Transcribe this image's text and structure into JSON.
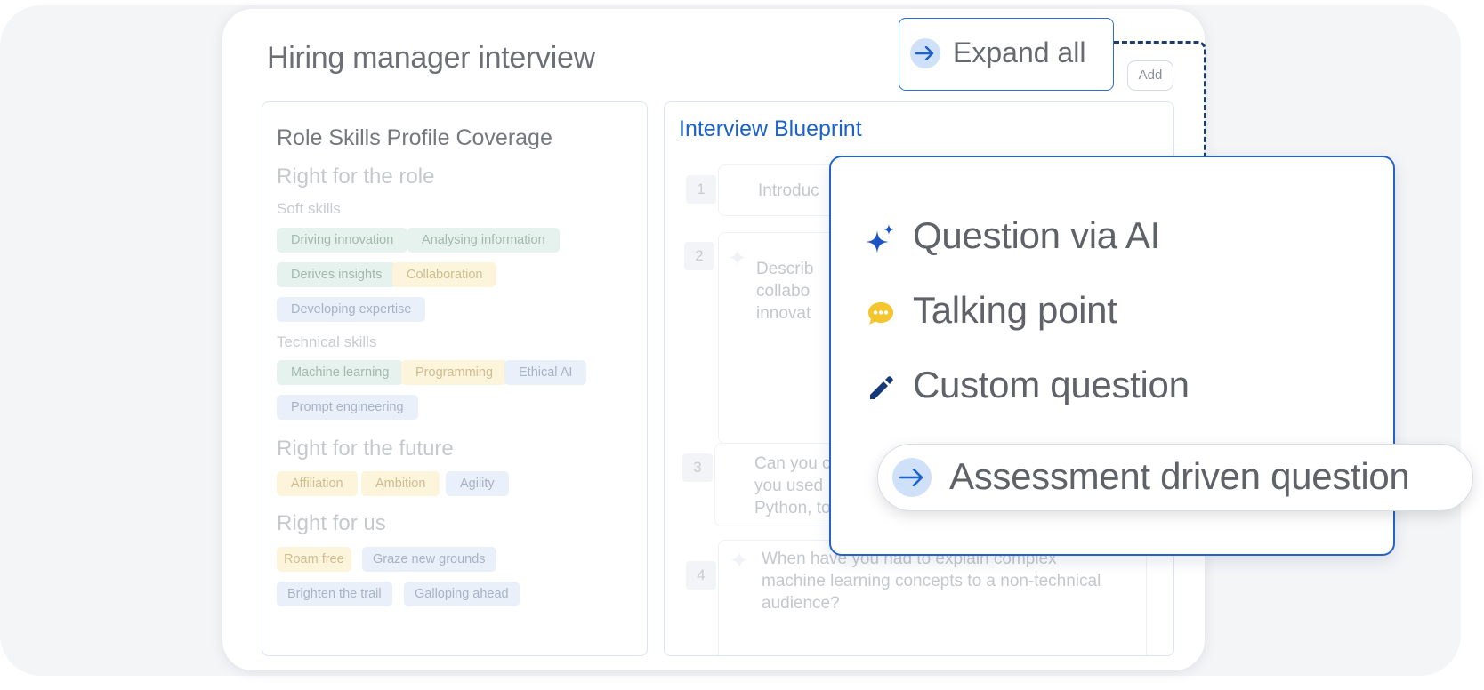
{
  "card": {
    "title": "Hiring manager interview",
    "add_label": "Add"
  },
  "skills": {
    "title": "Role Skills Profile Coverage",
    "sections": [
      {
        "heading": "Right for the role",
        "groups": [
          {
            "subheading": "Soft skills",
            "tags": [
              "Driving innovation",
              "Analysing information",
              "Derives insights",
              "Collaboration",
              "Developing expertise"
            ]
          },
          {
            "subheading": "Technical skills",
            "tags": [
              "Machine learning",
              "Programming",
              "Ethical AI",
              "Prompt engineering"
            ]
          }
        ]
      },
      {
        "heading": "Right for the future",
        "tags": [
          "Affiliation",
          "Ambition",
          "Agility"
        ]
      },
      {
        "heading": "Right for us",
        "tags": [
          "Roam free",
          "Graze new grounds",
          "Brighten the trail",
          "Galloping ahead"
        ]
      }
    ]
  },
  "blueprint": {
    "title": "Interview Blueprint",
    "questions": [
      {
        "num": "1",
        "text": "Introduc"
      },
      {
        "num": "2",
        "text": "Describ\ncollabo\ninnovat"
      },
      {
        "num": "3",
        "text": "Can you c\nyou used\nPython, to"
      },
      {
        "num": "4",
        "text": "When have you had to explain complex\nmachine learning concepts to a non-technical\naudience?"
      }
    ]
  },
  "expand_all": {
    "label": "Expand all"
  },
  "menu": {
    "items": [
      {
        "label": "Question via AI",
        "icon": "sparkle-icon"
      },
      {
        "label": "Talking point",
        "icon": "chat-bubble-icon"
      },
      {
        "label": "Custom question",
        "icon": "pencil-icon"
      }
    ],
    "highlighted": {
      "label": "Assessment driven question",
      "icon": "arrow-right-icon"
    }
  },
  "colors": {
    "accent": "#2564c6",
    "link": "#1b63c8",
    "talking_point": "#f5c52e",
    "tag_green": "#e6f2ed",
    "tag_yellow": "#fdf4dc",
    "tag_blue": "#eaf0f9"
  }
}
